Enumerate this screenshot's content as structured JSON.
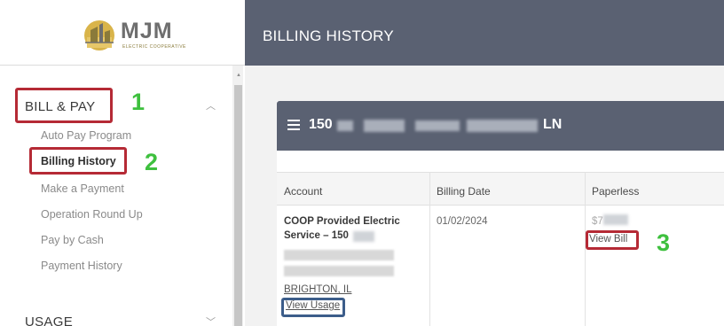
{
  "brand": {
    "name": "MJM",
    "tagline": "ELECTRIC COOPERATIVE"
  },
  "header": {
    "title": "BILLING HISTORY"
  },
  "sidebar": {
    "sections": [
      {
        "label": "BILL & PAY",
        "expanded": true,
        "items": [
          {
            "label": "Auto Pay Program"
          },
          {
            "label": "Billing History",
            "active": true
          },
          {
            "label": "Make a Payment"
          },
          {
            "label": "Operation Round Up"
          },
          {
            "label": "Pay by Cash"
          },
          {
            "label": "Payment History"
          }
        ]
      },
      {
        "label": "USAGE",
        "expanded": false
      }
    ]
  },
  "account_card": {
    "address_start": "150",
    "address_end": "LN",
    "columns": [
      "Account",
      "Billing Date",
      "Paperless"
    ],
    "row": {
      "account_name": "COOP Provided Electric Service – 150",
      "account_city": "BRIGHTON, IL",
      "view_usage": "View Usage",
      "billing_date": "01/02/2024",
      "paperless_value": "$7",
      "view_bill": "View Bill"
    }
  },
  "annotations": {
    "step1": "1",
    "step2": "2",
    "step3": "3"
  },
  "colors": {
    "header_bg": "#5a6172",
    "highlight_red": "#b52a35",
    "highlight_blue": "#3c5d8a",
    "step_green": "#3ec03e"
  },
  "icons": [
    "logo-icon",
    "chevron-up-icon",
    "chevron-down-icon",
    "menu-icon",
    "scroll-up-icon"
  ]
}
